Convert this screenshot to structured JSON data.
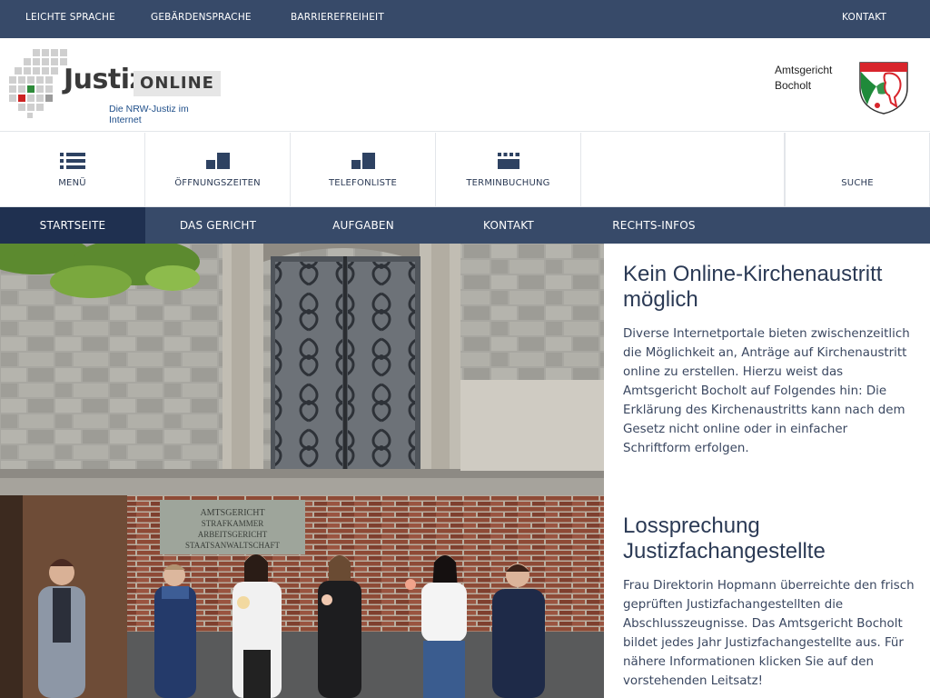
{
  "topbar": {
    "leichte_sprache": "Leichte Sprache",
    "gebaerdensprache": "Gebärdensprache",
    "barrierefreiheit": "Barrierefreiheit",
    "kontakt": "Kontakt"
  },
  "logo": {
    "word": "Justiz-",
    "online": "ONLINE",
    "tagline": "Die NRW-Justiz im Internet"
  },
  "court": {
    "line1": "Amtsgericht",
    "line2": "Bocholt"
  },
  "quicknav": {
    "menu": "Menü",
    "opening_hours": "Öffnungszeiten",
    "phone_list": "Telefonliste",
    "appointments": "Terminbuchung",
    "search": "Suche"
  },
  "mainnav": {
    "items": [
      "Startseite",
      "Das Gericht",
      "Aufgaben",
      "Kontakt",
      "Rechts-Infos"
    ],
    "active": "Startseite"
  },
  "articles": [
    {
      "title": "Kein Online-Kirchenaustritt möglich",
      "text": "Diverse Internetportale bieten zwischenzeitlich die Möglichkeit an, Anträge auf Kirchenaustritt online zu erstellen. Hierzu weist das Amtsgericht Bocholt auf Folgendes hin: Die Erklärung des Kirchenaustritts kann nach dem Gesetz nicht online oder in einfacher Schriftform erfolgen."
    },
    {
      "title": "Lossprechung Justizfachangestellte",
      "text": "Frau Direktorin Hopmann überreichte den frisch geprüften Justizfachangestellten die Abschlusszeugnisse. Das Amtsgericht Bocholt bildet jedes Jahr Justizfachangestellte aus. Für nähere Informationen klicken Sie auf den vorstehenden Leitsatz!"
    }
  ],
  "photo2_sign": {
    "line1": "AMTSGERICHT",
    "line2": "STRAFKAMMER",
    "line3": "ARBEITSGERICHT",
    "line4": "STAATSANWALTSCHAFT"
  },
  "colors": {
    "nav_bg": "#374a69",
    "nav_active": "#1f3050",
    "text": "#2b3a55"
  }
}
